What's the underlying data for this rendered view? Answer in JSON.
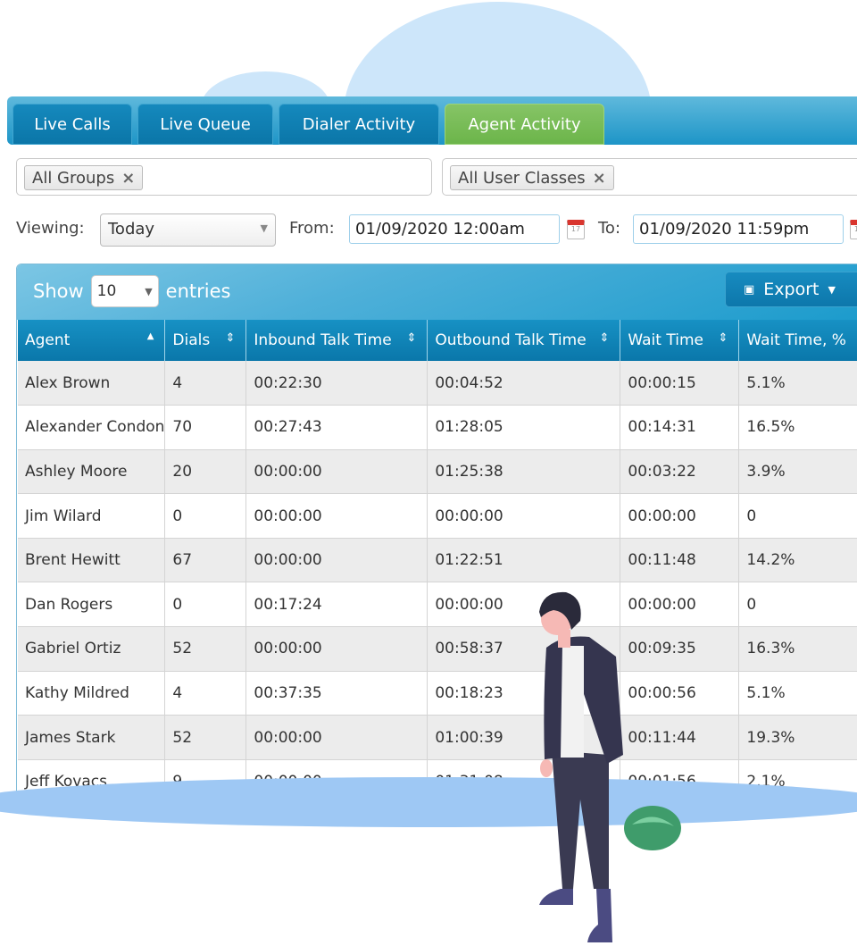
{
  "tabs": [
    {
      "label": "Live Calls"
    },
    {
      "label": "Live Queue"
    },
    {
      "label": "Dialer Activity"
    },
    {
      "label": "Agent Activity",
      "active": true
    }
  ],
  "filters": {
    "groups": "All Groups",
    "user_classes": "All User Classes",
    "remove_icon": "×"
  },
  "viewing": {
    "label": "Viewing:",
    "value": "Today",
    "from_label": "From:",
    "from": "01/09/2020 12:00am",
    "to_label": "To:",
    "to": "01/09/2020 11:59pm",
    "calendar_day": "17"
  },
  "table": {
    "show": "Show",
    "length": "10",
    "entries": "entries",
    "export": "Export",
    "columns": [
      "Agent",
      "Dials",
      "Inbound Talk Time",
      "Outbound Talk Time",
      "Wait Time",
      "Wait Time, %"
    ],
    "rows": [
      [
        "Alex Brown",
        "4",
        "00:22:30",
        "00:04:52",
        "00:00:15",
        "5.1%"
      ],
      [
        "Alexander Condon",
        "70",
        "00:27:43",
        "01:28:05",
        "00:14:31",
        "16.5%"
      ],
      [
        "Ashley Moore",
        "20",
        "00:00:00",
        "01:25:38",
        "00:03:22",
        "3.9%"
      ],
      [
        "Jim Wilard",
        "0",
        "00:00:00",
        "00:00:00",
        "00:00:00",
        "0"
      ],
      [
        "Brent Hewitt",
        "67",
        "00:00:00",
        "01:22:51",
        "00:11:48",
        "14.2%"
      ],
      [
        "Dan Rogers",
        "0",
        "00:17:24",
        "00:00:00",
        "00:00:00",
        "0"
      ],
      [
        "Gabriel Ortiz",
        "52",
        "00:00:00",
        "00:58:37",
        "00:09:35",
        "16.3%"
      ],
      [
        "Kathy Mildred",
        "4",
        "00:37:35",
        "00:18:23",
        "00:00:56",
        "5.1%"
      ],
      [
        "James Stark",
        "52",
        "00:00:00",
        "01:00:39",
        "00:11:44",
        "19.3%"
      ],
      [
        "Jeff Kovacs",
        "9",
        "00:00:00",
        "01:31:08",
        "00:01:56",
        "2.1%"
      ]
    ]
  },
  "colors": {
    "tab_blue": "#0b76a8",
    "tab_active": "#6cb54a",
    "header_blue": "#1791c4"
  }
}
